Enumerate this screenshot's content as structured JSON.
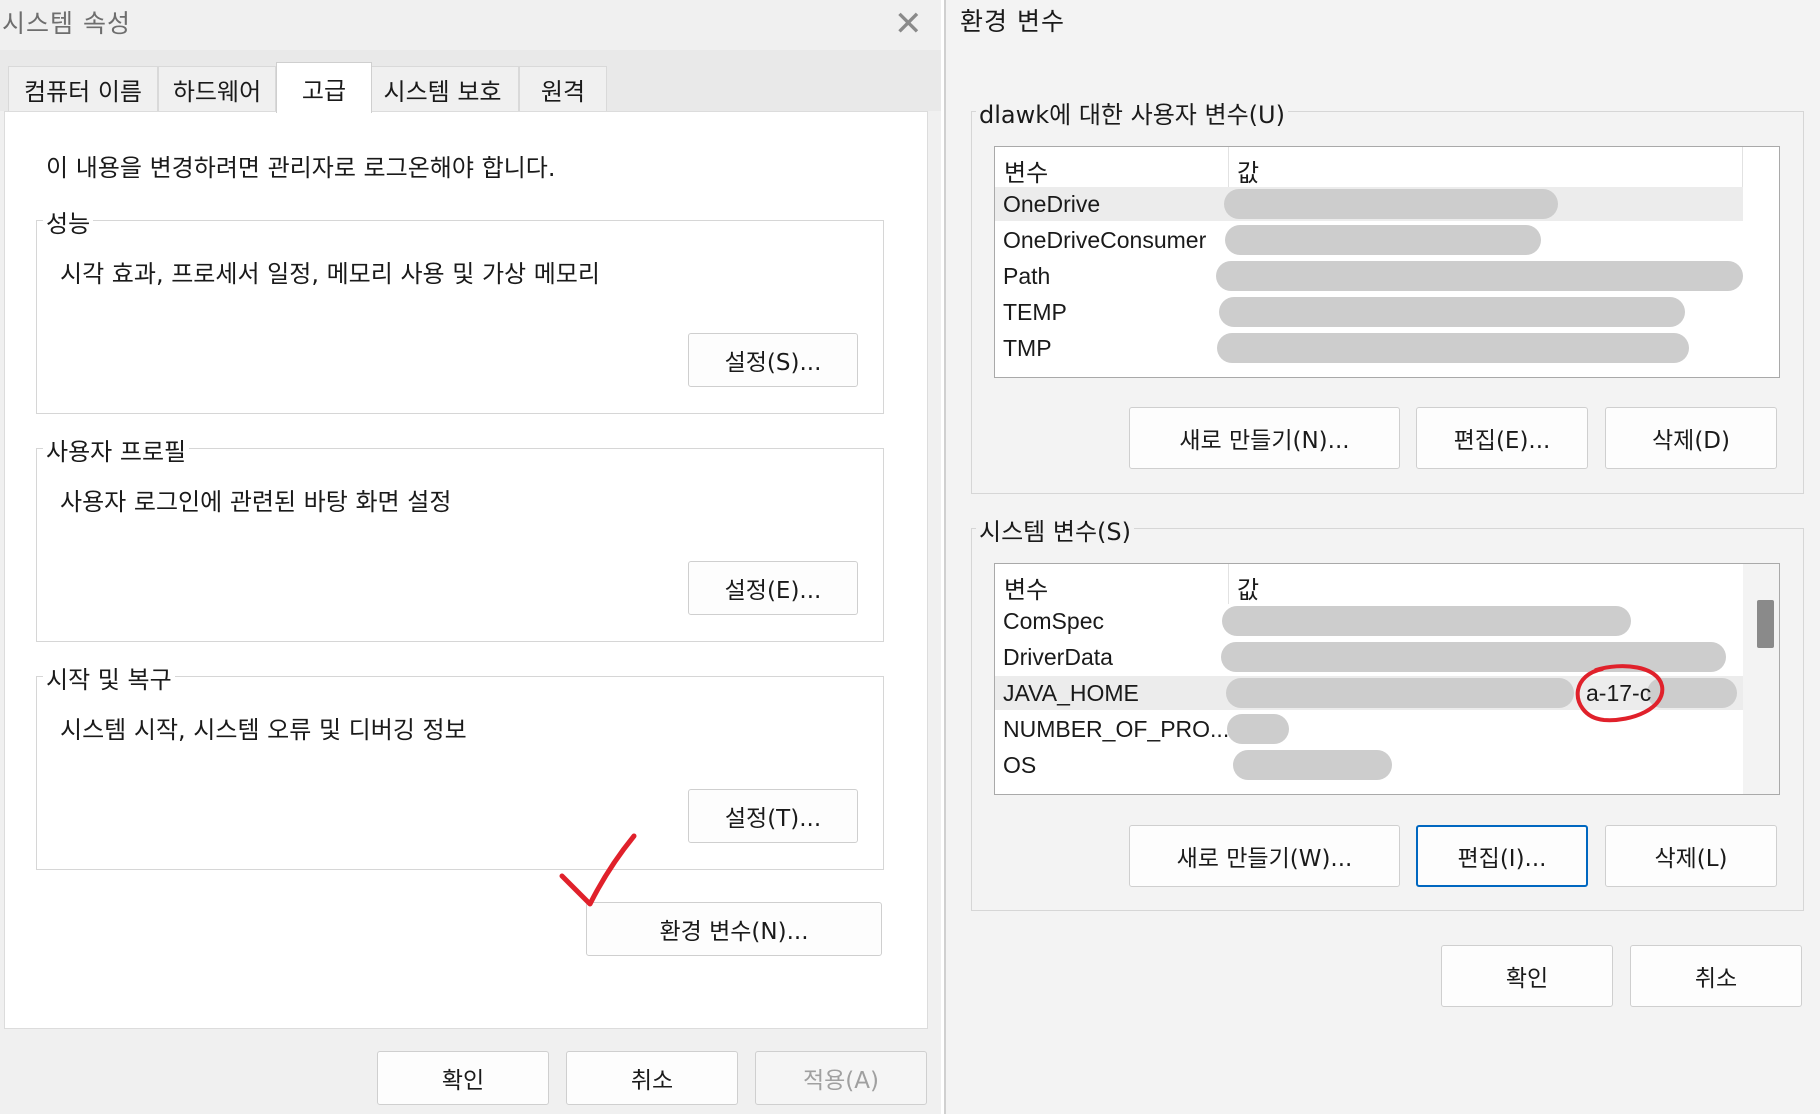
{
  "system_properties": {
    "title": "시스템 속성",
    "close_icon": "close-icon",
    "tabs": [
      {
        "label": "컴퓨터 이름"
      },
      {
        "label": "하드웨어"
      },
      {
        "label": "고급"
      },
      {
        "label": "시스템 보호"
      },
      {
        "label": "원격"
      }
    ],
    "active_tab": "고급",
    "admin_notice": "이 내용을 변경하려면 관리자로 로그온해야 합니다.",
    "groups": [
      {
        "title": "성능",
        "description": "시각 효과, 프로세서 일정, 메모리 사용 및 가상 메모리",
        "button": "설정(S)..."
      },
      {
        "title": "사용자 프로필",
        "description": "사용자 로그인에 관련된 바탕 화면 설정",
        "button": "설정(E)..."
      },
      {
        "title": "시작 및 복구",
        "description": "시스템 시작, 시스템 오류 및 디버깅 정보",
        "button": "설정(T)..."
      }
    ],
    "env_button": "환경 변수(N)...",
    "footer": {
      "ok": "확인",
      "cancel": "취소",
      "apply": "적용(A)"
    }
  },
  "environment_variables": {
    "title": "환경 변수",
    "user_section_title": "dlawk에 대한 사용자 변수(U)",
    "table_headers": {
      "name": "변수",
      "value": "값"
    },
    "user_variables": [
      {
        "name": "OneDrive"
      },
      {
        "name": "OneDriveConsumer"
      },
      {
        "name": "Path"
      },
      {
        "name": "TEMP"
      },
      {
        "name": "TMP"
      }
    ],
    "user_buttons": {
      "new": "새로 만들기(N)...",
      "edit": "편집(E)...",
      "delete": "삭제(D)"
    },
    "system_section_title": "시스템 변수(S)",
    "system_variables": [
      {
        "name": "ComSpec"
      },
      {
        "name": "DriverData"
      },
      {
        "name": "JAVA_HOME",
        "visible_value_fragment": "a-17-c"
      },
      {
        "name": "NUMBER_OF_PRO..."
      },
      {
        "name": "OS"
      }
    ],
    "system_buttons": {
      "new": "새로 만들기(W)...",
      "edit": "편집(I)...",
      "delete": "삭제(L)"
    },
    "footer": {
      "ok": "확인",
      "cancel": "취소"
    }
  },
  "annotations": {
    "checkmark_color": "#e0212b",
    "circle_color": "#e0212b"
  }
}
